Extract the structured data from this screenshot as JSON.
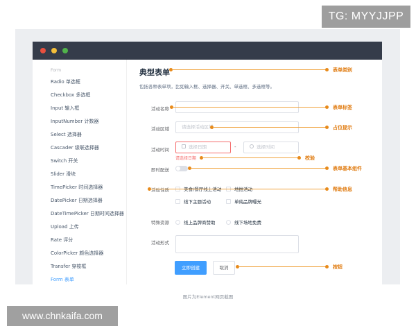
{
  "badge": "TG: MYYJJPP",
  "sidebar": {
    "heading": "Form",
    "items": [
      {
        "label": "Radio 单选框"
      },
      {
        "label": "Checkbox 多选框"
      },
      {
        "label": "Input 输入框"
      },
      {
        "label": "InputNumber 计数器"
      },
      {
        "label": "Select 选择器"
      },
      {
        "label": "Cascader 级联选择器"
      },
      {
        "label": "Switch 开关"
      },
      {
        "label": "Slider 滑块"
      },
      {
        "label": "TimePicker 时间选择器"
      },
      {
        "label": "DatePicker 日期选择器"
      },
      {
        "label": "DateTimePicker 日期时间选择器"
      },
      {
        "label": "Upload 上传"
      },
      {
        "label": "Rate 评分"
      },
      {
        "label": "ColorPicker 颜色选择器"
      },
      {
        "label": "Transfer 穿梭框"
      },
      {
        "label": "Form 表单"
      }
    ]
  },
  "page": {
    "title": "典型表单",
    "description": "包括各种表单项，比如输入框、选择器、开关、单选框、多选框等。"
  },
  "form": {
    "name_label": "活动名称",
    "area_label": "活动区域",
    "area_placeholder": "请选择活动区域",
    "time_label": "活动时间",
    "date_placeholder": "选择日期",
    "time_separator": "-",
    "time_placeholder": "选择时间",
    "date_error": "请选择日期",
    "delivery_label": "即时配送",
    "nature_label": "活动性质",
    "nature_options": [
      {
        "label": "美食/餐厅线上活动"
      },
      {
        "label": "地推活动"
      },
      {
        "label": "线下主题活动"
      },
      {
        "label": "单纯品牌曝光"
      }
    ],
    "resource_label": "特殊资源",
    "resource_options": [
      {
        "label": "线上品牌商赞助"
      },
      {
        "label": "线下场地免费"
      }
    ],
    "form_label": "活动形式",
    "create_button": "立即创建",
    "cancel_button": "取消"
  },
  "annotations": {
    "category": "表单类别",
    "label": "表单标签",
    "placeholder": "占位提示",
    "validation": "校验",
    "basic_component": "表单基本组件",
    "help": "帮助信息",
    "button": "按钮"
  },
  "caption": "图片为Element网页截图",
  "watermark": "www.chnkaifa.com",
  "colors": {
    "primary": "#409eff",
    "annotation": "#e88a1a",
    "error": "#f56c6c",
    "titlebar": "#353c4a"
  }
}
